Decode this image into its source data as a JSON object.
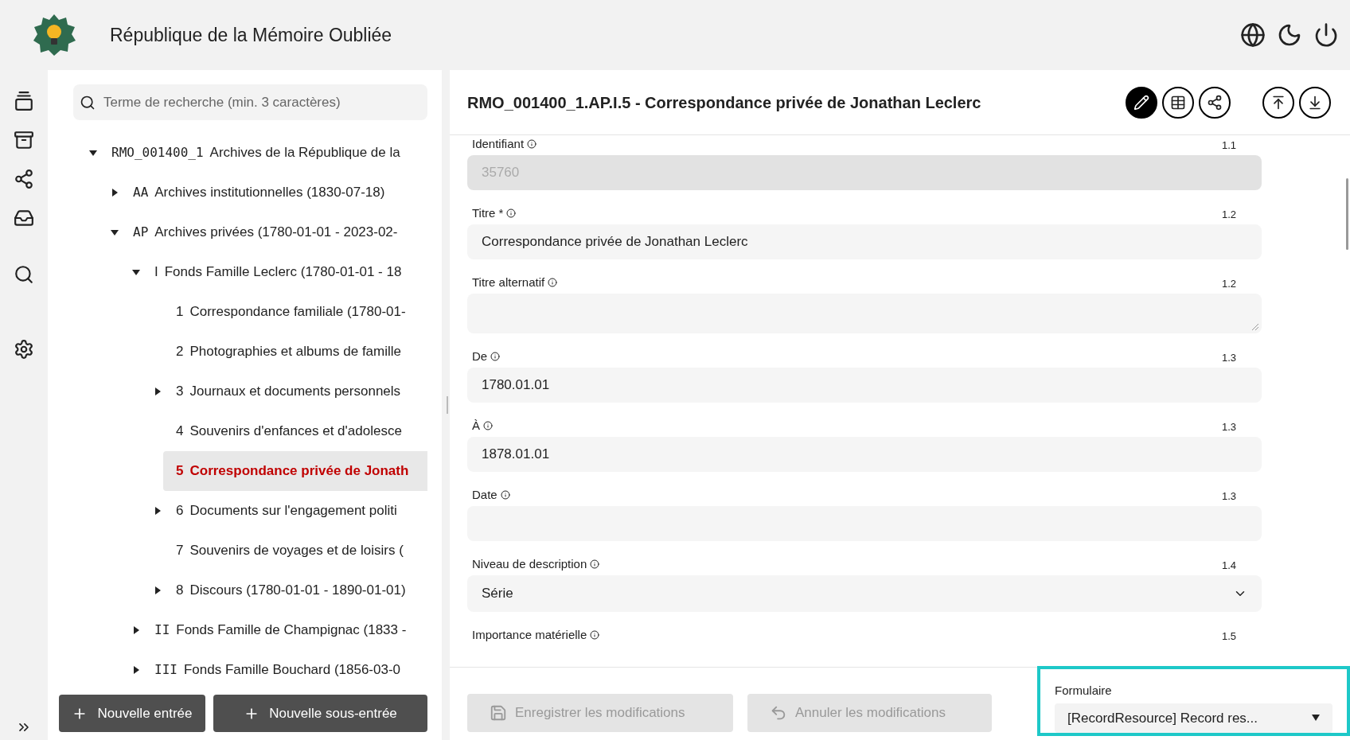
{
  "header": {
    "title": "République de la Mémoire Oubliée"
  },
  "search": {
    "placeholder": "Terme de recherche (min. 3 caractères)"
  },
  "tree": [
    {
      "code": "RMO_001400_1",
      "label": "Archives de la République de la",
      "expanded": true,
      "selected": false,
      "children": [
        {
          "code": "AA",
          "label": "Archives institutionnelles (1830-07-18)",
          "expanded": false,
          "selected": false,
          "has_children": true
        },
        {
          "code": "AP",
          "label": "Archives privées (1780-01-01 - 2023-02-",
          "expanded": true,
          "selected": false,
          "children": [
            {
              "code": "I",
              "label": "Fonds Famille Leclerc (1780-01-01 - 18",
              "expanded": true,
              "selected": false,
              "children": [
                {
                  "code": "1",
                  "label": "Correspondance familiale (1780-01-",
                  "selected": false,
                  "has_children": false
                },
                {
                  "code": "2",
                  "label": "Photographies et albums de famille",
                  "selected": false,
                  "has_children": false
                },
                {
                  "code": "3",
                  "label": "Journaux et documents personnels",
                  "expanded": false,
                  "selected": false,
                  "has_children": true
                },
                {
                  "code": "4",
                  "label": "Souvenirs d'enfances et d'adolesce",
                  "selected": false,
                  "has_children": false
                },
                {
                  "code": "5",
                  "label": "Correspondance privée de Jonath",
                  "selected": true,
                  "has_children": false
                },
                {
                  "code": "6",
                  "label": "Documents sur l'engagement politi",
                  "expanded": false,
                  "selected": false,
                  "has_children": true
                },
                {
                  "code": "7",
                  "label": "Souvenirs de voyages et de loisirs (",
                  "selected": false,
                  "has_children": false
                },
                {
                  "code": "8",
                  "label": "Discours (1780-01-01 - 1890-01-01)",
                  "expanded": false,
                  "selected": false,
                  "has_children": true
                }
              ]
            },
            {
              "code": "II",
              "label": "Fonds Famille de Champignac (1833 -",
              "expanded": false,
              "selected": false,
              "has_children": true
            },
            {
              "code": "III",
              "label": "Fonds Famille Bouchard (1856-03-0",
              "expanded": false,
              "selected": false,
              "has_children": true
            }
          ]
        }
      ]
    }
  ],
  "tree_buttons": [
    "Nouvelle entrée",
    "Nouvelle sous-entrée"
  ],
  "record": {
    "title": "RMO_001400_1.AP.I.5 - Correspondance privée de Jonathan Leclerc",
    "edit_mode": true
  },
  "fields": [
    {
      "kind": "input",
      "label": "Identifiant",
      "number": "1.1",
      "value": "35760",
      "disabled": true
    },
    {
      "kind": "input",
      "label": "Titre *",
      "number": "1.2",
      "value": "Correspondance privée de Jonathan Leclerc",
      "disabled": false
    },
    {
      "kind": "textarea",
      "label": "Titre alternatif",
      "number": "1.2",
      "disabled": false
    },
    {
      "kind": "input",
      "label": "De",
      "number": "1.3",
      "value": "1780.01.01",
      "disabled": false
    },
    {
      "kind": "input",
      "label": "À",
      "number": "1.3",
      "value": "1878.01.01",
      "disabled": false
    },
    {
      "kind": "input",
      "label": "Date",
      "number": "1.3",
      "disabled": false
    },
    {
      "kind": "select",
      "label": "Niveau de description",
      "number": "1.4",
      "value": "Série",
      "disabled": false
    },
    {
      "kind": "label_only",
      "label": "Importance matérielle",
      "number": "1.5"
    }
  ],
  "actions": [
    {
      "label": "Enregistrer les modifications",
      "kind": "save",
      "disabled": true
    },
    {
      "label": "Annuler les modifications",
      "kind": "undo",
      "disabled": true
    }
  ],
  "form_select": {
    "label": "Formulaire",
    "value": "[RecordResource] Record res..."
  }
}
